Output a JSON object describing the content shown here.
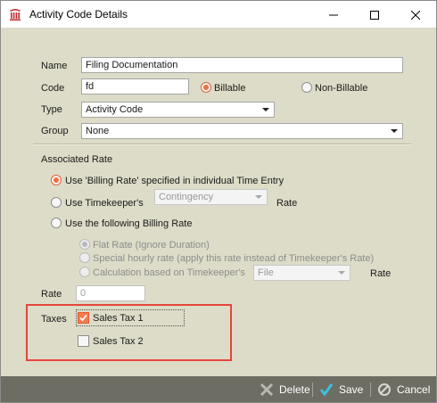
{
  "window": {
    "title": "Activity Code Details"
  },
  "form": {
    "name_label": "Name",
    "name_value": "Filing Documentation",
    "code_label": "Code",
    "code_value": "fd",
    "billable_label": "Billable",
    "nonbillable_label": "Non-Billable",
    "type_label": "Type",
    "type_value": "Activity Code",
    "group_label": "Group",
    "group_value": "None"
  },
  "associated_rate": {
    "heading": "Associated Rate",
    "opt_billing_rate": "Use 'Billing Rate' specified in individual Time Entry",
    "opt_timekeeper": "Use Timekeeper's",
    "timekeeper_value": "Contingency",
    "rate_suffix": "Rate",
    "opt_following": "Use the following Billing Rate",
    "sub_flat": "Flat Rate (Ignore Duration)",
    "sub_special": "Special hourly rate (apply this rate instead of Timekeeper's Rate)",
    "sub_calc": "Calculation based on Timekeeper's",
    "calc_value": "File",
    "calc_rate_suffix": "Rate",
    "rate_label": "Rate",
    "rate_value": "0"
  },
  "taxes": {
    "label": "Taxes",
    "items": [
      {
        "label": "Sales Tax 1",
        "checked": true
      },
      {
        "label": "Sales Tax 2",
        "checked": false
      }
    ]
  },
  "actions": {
    "delete_label": "Delete",
    "save_label": "Save",
    "cancel_label": "Cancel"
  },
  "colors": {
    "accent": "#f07040",
    "highlight_border": "#e5453b",
    "dialog_bg": "#dddcc8",
    "bottom_bar": "#6e6d63",
    "save_check": "#3fbfe0"
  }
}
